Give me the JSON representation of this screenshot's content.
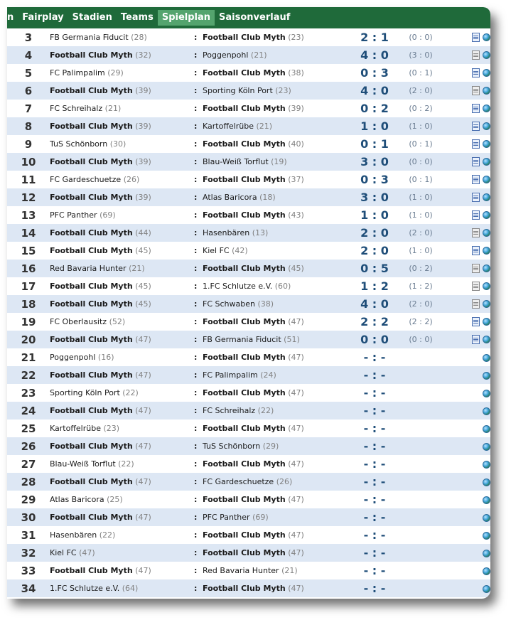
{
  "nav": {
    "tabs": [
      {
        "label": "n"
      },
      {
        "label": "Fairplay"
      },
      {
        "label": "Stadien"
      },
      {
        "label": "Teams"
      },
      {
        "label": "Spielplan"
      },
      {
        "label": "Saisonverlauf"
      }
    ]
  },
  "matches": [
    {
      "md": "3",
      "home": "FB Germania Fiducit",
      "home_pts": "(28)",
      "away": "Football Club Myth",
      "away_pts": "(23)",
      "score": "2 : 1",
      "half": "(0 : 0)",
      "doc": "blue"
    },
    {
      "md": "4",
      "home": "Football Club Myth",
      "home_pts": "(32)",
      "away": "Poggenpohl",
      "away_pts": "(21)",
      "score": "4 : 0",
      "half": "(3 : 0)",
      "doc": "gray"
    },
    {
      "md": "5",
      "home": "FC Palimpalim",
      "home_pts": "(29)",
      "away": "Football Club Myth",
      "away_pts": "(38)",
      "score": "0 : 3",
      "half": "(0 : 1)",
      "doc": "blue"
    },
    {
      "md": "6",
      "home": "Football Club Myth",
      "home_pts": "(39)",
      "away": "Sporting Köln Port",
      "away_pts": "(23)",
      "score": "4 : 0",
      "half": "(2 : 0)",
      "doc": "gray"
    },
    {
      "md": "7",
      "home": "FC Schreihalz",
      "home_pts": "(21)",
      "away": "Football Club Myth",
      "away_pts": "(39)",
      "score": "0 : 2",
      "half": "(0 : 2)",
      "doc": "blue"
    },
    {
      "md": "8",
      "home": "Football Club Myth",
      "home_pts": "(39)",
      "away": "Kartoffelrübe",
      "away_pts": "(21)",
      "score": "1 : 0",
      "half": "(1 : 0)",
      "doc": "blue"
    },
    {
      "md": "9",
      "home": "TuS Schönborn",
      "home_pts": "(30)",
      "away": "Football Club Myth",
      "away_pts": "(40)",
      "score": "0 : 1",
      "half": "(0 : 1)",
      "doc": "blue"
    },
    {
      "md": "10",
      "home": "Football Club Myth",
      "home_pts": "(39)",
      "away": "Blau-Weiß Torflut",
      "away_pts": "(19)",
      "score": "3 : 0",
      "half": "(0 : 0)",
      "doc": "blue"
    },
    {
      "md": "11",
      "home": "FC Gardeschuetze",
      "home_pts": "(26)",
      "away": "Football Club Myth",
      "away_pts": "(37)",
      "score": "0 : 3",
      "half": "(0 : 1)",
      "doc": "blue"
    },
    {
      "md": "12",
      "home": "Football Club Myth",
      "home_pts": "(39)",
      "away": "Atlas Baricora",
      "away_pts": "(18)",
      "score": "3 : 0",
      "half": "(1 : 0)",
      "doc": "blue"
    },
    {
      "md": "13",
      "home": "PFC Panther",
      "home_pts": "(69)",
      "away": "Football Club Myth",
      "away_pts": "(43)",
      "score": "1 : 0",
      "half": "(1 : 0)",
      "doc": "blue"
    },
    {
      "md": "14",
      "home": "Football Club Myth",
      "home_pts": "(44)",
      "away": "Hasenbären",
      "away_pts": "(13)",
      "score": "2 : 0",
      "half": "(2 : 0)",
      "doc": "gray"
    },
    {
      "md": "15",
      "home": "Football Club Myth",
      "home_pts": "(45)",
      "away": "Kiel FC",
      "away_pts": "(42)",
      "score": "2 : 0",
      "half": "(1 : 0)",
      "doc": "blue"
    },
    {
      "md": "16",
      "home": "Red Bavaria Hunter",
      "home_pts": "(21)",
      "away": "Football Club Myth",
      "away_pts": "(45)",
      "score": "0 : 5",
      "half": "(0 : 2)",
      "doc": "gray"
    },
    {
      "md": "17",
      "home": "Football Club Myth",
      "home_pts": "(45)",
      "away": "1.FC Schlutze e.V.",
      "away_pts": "(60)",
      "score": "1 : 2",
      "half": "(1 : 2)",
      "doc": "gray"
    },
    {
      "md": "18",
      "home": "Football Club Myth",
      "home_pts": "(45)",
      "away": "FC Schwaben",
      "away_pts": "(38)",
      "score": "4 : 0",
      "half": "(2 : 0)",
      "doc": "gray"
    },
    {
      "md": "19",
      "home": "FC Oberlausitz",
      "home_pts": "(52)",
      "away": "Football Club Myth",
      "away_pts": "(47)",
      "score": "2 : 2",
      "half": "(2 : 2)",
      "doc": "blue"
    },
    {
      "md": "20",
      "home": "Football Club Myth",
      "home_pts": "(47)",
      "away": "FB Germania Fiducit",
      "away_pts": "(51)",
      "score": "0 : 0",
      "half": "(0 : 0)",
      "doc": "blue"
    },
    {
      "md": "21",
      "home": "Poggenpohl",
      "home_pts": "(16)",
      "away": "Football Club Myth",
      "away_pts": "(47)",
      "score": "- : -",
      "half": "",
      "doc": ""
    },
    {
      "md": "22",
      "home": "Football Club Myth",
      "home_pts": "(47)",
      "away": "FC Palimpalim",
      "away_pts": "(24)",
      "score": "- : -",
      "half": "",
      "doc": ""
    },
    {
      "md": "23",
      "home": "Sporting Köln Port",
      "home_pts": "(22)",
      "away": "Football Club Myth",
      "away_pts": "(47)",
      "score": "- : -",
      "half": "",
      "doc": ""
    },
    {
      "md": "24",
      "home": "Football Club Myth",
      "home_pts": "(47)",
      "away": "FC Schreihalz",
      "away_pts": "(22)",
      "score": "- : -",
      "half": "",
      "doc": ""
    },
    {
      "md": "25",
      "home": "Kartoffelrübe",
      "home_pts": "(23)",
      "away": "Football Club Myth",
      "away_pts": "(47)",
      "score": "- : -",
      "half": "",
      "doc": ""
    },
    {
      "md": "26",
      "home": "Football Club Myth",
      "home_pts": "(47)",
      "away": "TuS Schönborn",
      "away_pts": "(29)",
      "score": "- : -",
      "half": "",
      "doc": ""
    },
    {
      "md": "27",
      "home": "Blau-Weiß Torflut",
      "home_pts": "(22)",
      "away": "Football Club Myth",
      "away_pts": "(47)",
      "score": "- : -",
      "half": "",
      "doc": ""
    },
    {
      "md": "28",
      "home": "Football Club Myth",
      "home_pts": "(47)",
      "away": "FC Gardeschuetze",
      "away_pts": "(26)",
      "score": "- : -",
      "half": "",
      "doc": ""
    },
    {
      "md": "29",
      "home": "Atlas Baricora",
      "home_pts": "(25)",
      "away": "Football Club Myth",
      "away_pts": "(47)",
      "score": "- : -",
      "half": "",
      "doc": ""
    },
    {
      "md": "30",
      "home": "Football Club Myth",
      "home_pts": "(47)",
      "away": "PFC Panther",
      "away_pts": "(69)",
      "score": "- : -",
      "half": "",
      "doc": ""
    },
    {
      "md": "31",
      "home": "Hasenbären",
      "home_pts": "(22)",
      "away": "Football Club Myth",
      "away_pts": "(47)",
      "score": "- : -",
      "half": "",
      "doc": ""
    },
    {
      "md": "32",
      "home": "Kiel FC",
      "home_pts": "(47)",
      "away": "Football Club Myth",
      "away_pts": "(47)",
      "score": "- : -",
      "half": "",
      "doc": ""
    },
    {
      "md": "33",
      "home": "Football Club Myth",
      "home_pts": "(47)",
      "away": "Red Bavaria Hunter",
      "away_pts": "(21)",
      "score": "- : -",
      "half": "",
      "doc": ""
    },
    {
      "md": "34",
      "home": "1.FC Schlutze e.V.",
      "home_pts": "(64)",
      "away": "Football Club Myth",
      "away_pts": "(47)",
      "score": "- : -",
      "half": "",
      "doc": ""
    }
  ],
  "separator": ":",
  "own_team": "Football Club Myth",
  "colors": {
    "nav_bg": "#1f6a3a",
    "tab_active": "#54a46e",
    "row_alt": "#dde7f4",
    "score": "#1f4e79"
  }
}
